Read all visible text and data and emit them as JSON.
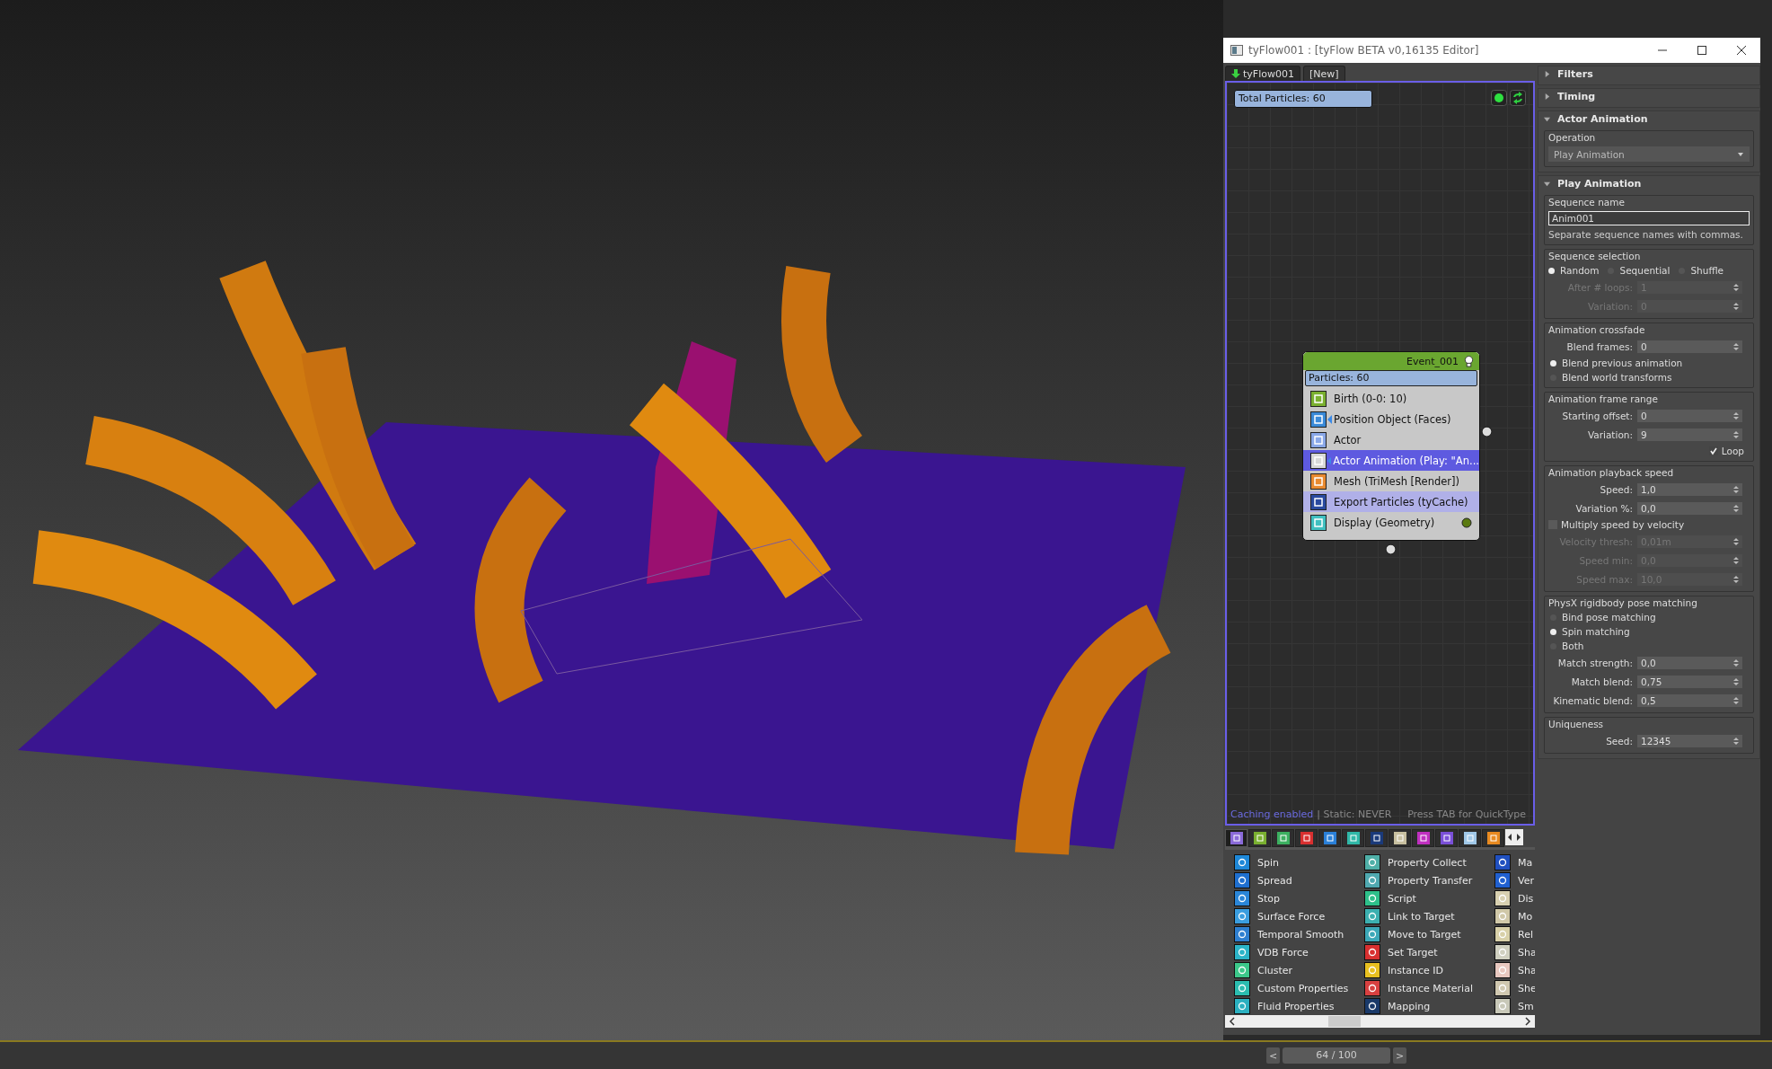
{
  "window": {
    "title": "tyFlow001 : [tyFlow BETA v0,16135 Editor]"
  },
  "flow_tabs": [
    {
      "label": "tyFlow001",
      "selected": true
    },
    {
      "label": "[New]",
      "selected": false
    }
  ],
  "graph": {
    "total_particles": "Total Particles: 60",
    "event": {
      "name": "Event_001",
      "particles": "Particles: 60",
      "operators": [
        {
          "label": "Birth (0-0: 10)",
          "color": "#7ab030",
          "selected": false,
          "highlighted": false,
          "linked": false,
          "indicator": false
        },
        {
          "label": "Position Object (Faces)",
          "color": "#3a8ad8",
          "selected": false,
          "highlighted": false,
          "linked": true,
          "indicator": false
        },
        {
          "label": "Actor",
          "color": "#8aa8e8",
          "selected": false,
          "highlighted": false,
          "linked": false,
          "indicator": false
        },
        {
          "label": "Actor Animation (Play: \"An...",
          "color": "#d8d8d8",
          "selected": true,
          "highlighted": false,
          "linked": true,
          "indicator": false
        },
        {
          "label": "Mesh (TriMesh [Render])",
          "color": "#e88a30",
          "selected": false,
          "highlighted": false,
          "linked": false,
          "indicator": false
        },
        {
          "label": "Export Particles (tyCache)",
          "color": "#2a4aa0",
          "selected": false,
          "highlighted": true,
          "linked": false,
          "indicator": false
        },
        {
          "label": "Display (Geometry)",
          "color": "#40c0c0",
          "selected": false,
          "highlighted": false,
          "linked": false,
          "indicator": true
        }
      ]
    },
    "status": {
      "caching": "Caching enabled",
      "static": "| Static: NEVER",
      "hint": "Press TAB for QuickType"
    }
  },
  "categories": [
    {
      "color": "#8a6ad8",
      "selected": true
    },
    {
      "color": "#7ab030",
      "selected": false
    },
    {
      "color": "#3cb060",
      "selected": false
    },
    {
      "color": "#d83030",
      "selected": false
    },
    {
      "color": "#2a80d8",
      "selected": false
    },
    {
      "color": "#30b8a8",
      "selected": false
    },
    {
      "color": "#1a3a7a",
      "selected": false
    },
    {
      "color": "#c8c0a0",
      "selected": false
    },
    {
      "color": "#c030c0",
      "selected": false
    },
    {
      "color": "#7a50d8",
      "selected": false
    },
    {
      "color": "#a0c8e8",
      "selected": false
    },
    {
      "color": "#e88a20",
      "selected": false
    }
  ],
  "palette": [
    [
      {
        "label": "Spin",
        "color": "#1e88d8"
      },
      {
        "label": "Spread",
        "color": "#1e6fd0"
      },
      {
        "label": "Stop",
        "color": "#2a86d8"
      },
      {
        "label": "Surface Force",
        "color": "#3a9ee0"
      },
      {
        "label": "Temporal Smooth",
        "color": "#2e7fd0"
      },
      {
        "label": "VDB Force",
        "color": "#2bb4c8"
      },
      {
        "label": "Cluster",
        "color": "#3cc88a"
      },
      {
        "label": "Custom Properties",
        "color": "#2bbdb0"
      },
      {
        "label": "Fluid Properties",
        "color": "#2bb0c0"
      }
    ],
    [
      {
        "label": "Property Collect",
        "color": "#4fb0a8"
      },
      {
        "label": "Property Transfer",
        "color": "#4fa8b0"
      },
      {
        "label": "Script",
        "color": "#2ec08a"
      },
      {
        "label": "Link to Target",
        "color": "#3cb0b0"
      },
      {
        "label": "Move to Target",
        "color": "#3ca8b8"
      },
      {
        "label": "Set Target",
        "color": "#d83030"
      },
      {
        "label": "Instance ID",
        "color": "#e8c020"
      },
      {
        "label": "Instance Material",
        "color": "#d84040"
      },
      {
        "label": "Mapping",
        "color": "#1a3a6a"
      }
    ],
    [
      {
        "label": "Ma",
        "color": "#2050c0"
      },
      {
        "label": "Ver",
        "color": "#2060d0"
      },
      {
        "label": "Dis",
        "color": "#d8d0b0"
      },
      {
        "label": "Mo",
        "color": "#d0c8a8"
      },
      {
        "label": "Rel",
        "color": "#d8d0a8"
      },
      {
        "label": "Sha",
        "color": "#d0d0c0"
      },
      {
        "label": "Sha",
        "color": "#e8c8c0"
      },
      {
        "label": "She",
        "color": "#d0c8b0"
      },
      {
        "label": "Sm",
        "color": "#c8c8b8"
      }
    ]
  ],
  "rollouts": [
    {
      "title": "Filters",
      "expanded": false
    },
    {
      "title": "Timing",
      "expanded": false
    },
    {
      "title": "Actor Animation",
      "expanded": true,
      "groups": [
        {
          "label": "Operation",
          "rows": [
            {
              "kind": "dropdown",
              "value": "Play Animation"
            }
          ]
        }
      ]
    },
    {
      "title": "Play Animation",
      "expanded": true,
      "groups": [
        {
          "label": "Sequence name",
          "rows": [
            {
              "kind": "text",
              "value": "Anim001"
            },
            {
              "kind": "note",
              "text": "Separate sequence names with commas."
            }
          ]
        },
        {
          "label": "Sequence selection",
          "rows": [
            {
              "kind": "radios",
              "options": [
                {
                  "label": "Random",
                  "selected": true
                },
                {
                  "label": "Sequential",
                  "selected": false
                },
                {
                  "label": "Shuffle",
                  "selected": false
                }
              ]
            },
            {
              "kind": "spinner",
              "label": "After # loops:",
              "value": "1",
              "disabled": true
            },
            {
              "kind": "spinner",
              "label": "Variation:",
              "value": "0",
              "disabled": true
            }
          ]
        },
        {
          "label": "Animation crossfade",
          "rows": [
            {
              "kind": "spinner",
              "label": "Blend frames:",
              "value": "0",
              "disabled": false
            },
            {
              "kind": "radio",
              "label": "Blend previous animation",
              "selected": true
            },
            {
              "kind": "radio",
              "label": "Blend world transforms",
              "selected": false
            }
          ]
        },
        {
          "label": "Animation frame range",
          "rows": [
            {
              "kind": "spinner",
              "label": "Starting offset:",
              "value": "0",
              "disabled": false
            },
            {
              "kind": "spinner",
              "label": "Variation:",
              "value": "9",
              "disabled": false
            },
            {
              "kind": "rightcheck",
              "label": "Loop",
              "checked": true
            }
          ]
        },
        {
          "label": "Animation playback speed",
          "rows": [
            {
              "kind": "spinner",
              "label": "Speed:",
              "value": "1,0",
              "disabled": false
            },
            {
              "kind": "spinner",
              "label": "Variation %:",
              "value": "0,0",
              "disabled": false
            },
            {
              "kind": "checkbox",
              "label": "Multiply speed by velocity",
              "checked": false
            },
            {
              "kind": "spinner",
              "label": "Velocity thresh:",
              "value": "0,01m",
              "disabled": true
            },
            {
              "kind": "spinner",
              "label": "Speed min:",
              "value": "0,0",
              "disabled": true
            },
            {
              "kind": "spinner",
              "label": "Speed max:",
              "value": "10,0",
              "disabled": true
            }
          ]
        },
        {
          "label": "PhysX rigidbody pose matching",
          "rows": [
            {
              "kind": "radio",
              "label": "Bind pose matching",
              "selected": false
            },
            {
              "kind": "radio",
              "label": "Spin matching",
              "selected": true
            },
            {
              "kind": "radio",
              "label": "Both",
              "selected": false
            },
            {
              "kind": "spinner",
              "label": "Match strength:",
              "value": "0,0",
              "disabled": false
            },
            {
              "kind": "spinner",
              "label": "Match blend:",
              "value": "0,75",
              "disabled": false
            },
            {
              "kind": "spinner",
              "label": "Kinematic blend:",
              "value": "0,5",
              "disabled": false
            }
          ]
        },
        {
          "label": "Uniqueness",
          "rows": [
            {
              "kind": "spinner",
              "label": "Seed:",
              "value": "12345",
              "disabled": false
            }
          ]
        }
      ]
    }
  ],
  "timeline": {
    "prev": "<",
    "frame": "64 / 100",
    "next": ">"
  }
}
